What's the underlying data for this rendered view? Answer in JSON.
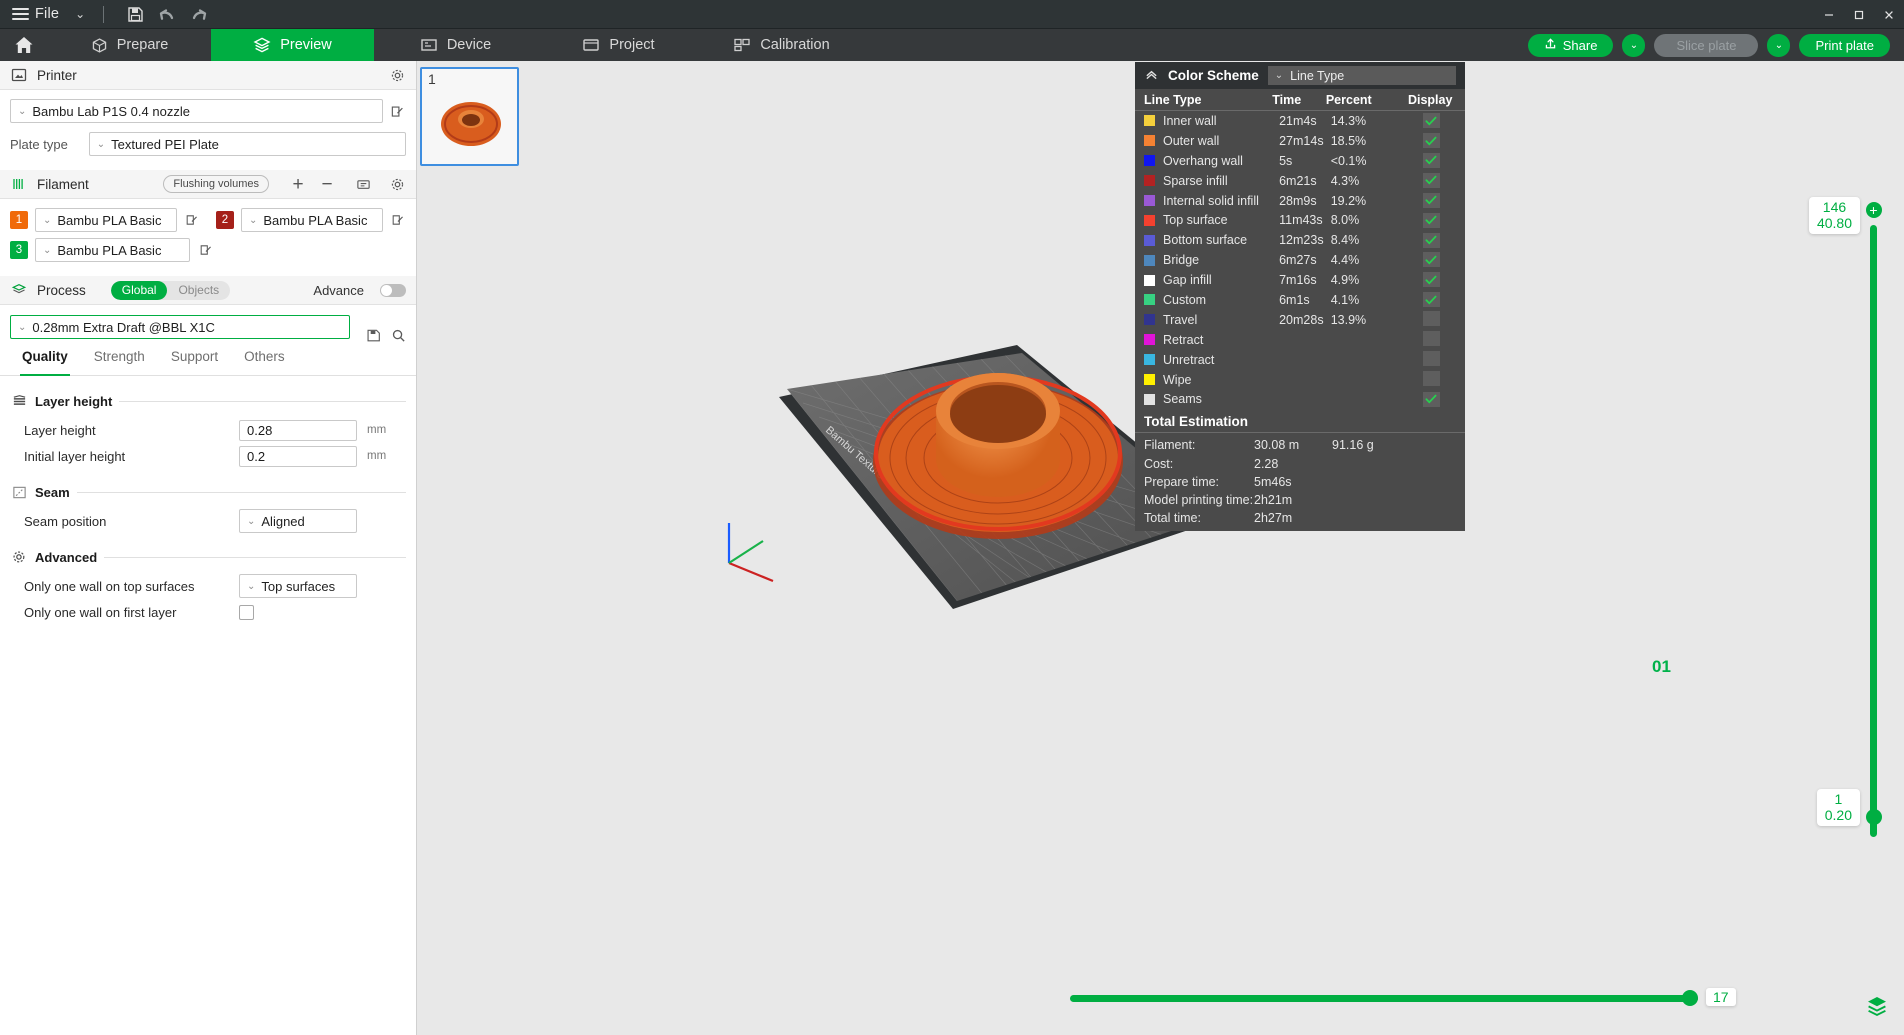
{
  "titlebar": {
    "menu_label": "File",
    "caret": "⌄",
    "icons": [
      "save-icon",
      "undo-icon",
      "redo-icon"
    ],
    "window_controls": [
      "minimize",
      "maximize",
      "close"
    ]
  },
  "tabs": [
    {
      "label": "Prepare",
      "icon": "cube-icon",
      "active": false
    },
    {
      "label": "Preview",
      "icon": "layers-icon",
      "active": true
    },
    {
      "label": "Device",
      "icon": "device-icon",
      "active": false
    },
    {
      "label": "Project",
      "icon": "folder-icon",
      "active": false
    },
    {
      "label": "Calibration",
      "icon": "calibration-icon",
      "active": false
    }
  ],
  "toolbar_right": {
    "share_label": "Share",
    "slice_label": "Slice plate",
    "print_label": "Print plate",
    "caret": "⌄"
  },
  "printer": {
    "section_title": "Printer",
    "preset": "Bambu Lab P1S 0.4 nozzle",
    "plate_type_label": "Plate type",
    "plate_type": "Textured PEI Plate"
  },
  "filament": {
    "section_title": "Filament",
    "flushing_label": "Flushing volumes",
    "add": "+",
    "remove": "−",
    "items": [
      {
        "index": "1",
        "name": "Bambu PLA Basic",
        "color": "#f06a0a"
      },
      {
        "index": "2",
        "name": "Bambu PLA Basic",
        "color": "#a52019"
      },
      {
        "index": "3",
        "name": "Bambu PLA Basic",
        "color": "#00ae42"
      }
    ]
  },
  "process": {
    "section_title": "Process",
    "scope_global": "Global",
    "scope_objects": "Objects",
    "advance_label": "Advance",
    "preset": "0.28mm Extra Draft @BBL X1C",
    "tabs": [
      {
        "label": "Quality",
        "active": true
      },
      {
        "label": "Strength",
        "active": false
      },
      {
        "label": "Support",
        "active": false
      },
      {
        "label": "Others",
        "active": false
      }
    ],
    "groups": [
      {
        "title": "Layer height",
        "icon": "layer-height-icon",
        "rows": [
          {
            "label": "Layer height",
            "type": "input",
            "value": "0.28",
            "unit": "mm"
          },
          {
            "label": "Initial layer height",
            "type": "input",
            "value": "0.2",
            "unit": "mm"
          }
        ]
      },
      {
        "title": "Seam",
        "icon": "seam-icon",
        "rows": [
          {
            "label": "Seam position",
            "type": "combo",
            "value": "Aligned",
            "unit": ""
          }
        ]
      },
      {
        "title": "Advanced",
        "icon": "gear-icon",
        "rows": [
          {
            "label": "Only one wall on top surfaces",
            "type": "combo",
            "value": "Top surfaces",
            "unit": ""
          },
          {
            "label": "Only one wall on first layer",
            "type": "checkbox",
            "value": "",
            "unit": ""
          }
        ]
      }
    ]
  },
  "plate_strip": {
    "thumbnail_number": "1"
  },
  "viewport": {
    "plate_label": "01",
    "bed_text": "Bambu Textured PEI Plate"
  },
  "color_scheme": {
    "title": "Color Scheme",
    "selected_view": "Line Type",
    "collapse_icon": "chevron-up-icon",
    "columns": [
      "Line Type",
      "Time",
      "Percent",
      "Display"
    ],
    "rows": [
      {
        "name": "Inner wall",
        "time": "21m4s",
        "percent": "14.3%",
        "color": "#f5d03c",
        "display": true
      },
      {
        "name": "Outer wall",
        "time": "27m14s",
        "percent": "18.5%",
        "color": "#f58233",
        "display": true
      },
      {
        "name": "Overhang wall",
        "time": "5s",
        "percent": "<0.1%",
        "color": "#1016f0",
        "display": true
      },
      {
        "name": "Sparse infill",
        "time": "6m21s",
        "percent": "4.3%",
        "color": "#b32222",
        "display": true
      },
      {
        "name": "Internal solid infill",
        "time": "28m9s",
        "percent": "19.2%",
        "color": "#9a59d6",
        "display": true
      },
      {
        "name": "Top surface",
        "time": "11m43s",
        "percent": "8.0%",
        "color": "#f4412f",
        "display": true
      },
      {
        "name": "Bottom surface",
        "time": "12m23s",
        "percent": "8.4%",
        "color": "#5a5bd6",
        "display": true
      },
      {
        "name": "Bridge",
        "time": "6m27s",
        "percent": "4.4%",
        "color": "#4e87bd",
        "display": true
      },
      {
        "name": "Gap infill",
        "time": "7m16s",
        "percent": "4.9%",
        "color": "#ffffff",
        "display": true
      },
      {
        "name": "Custom",
        "time": "6m1s",
        "percent": "4.1%",
        "color": "#37d182",
        "display": true
      },
      {
        "name": "Travel",
        "time": "20m28s",
        "percent": "13.9%",
        "color": "#31348f",
        "display": false
      },
      {
        "name": "Retract",
        "time": "",
        "percent": "",
        "color": "#e014d8",
        "display": false
      },
      {
        "name": "Unretract",
        "time": "",
        "percent": "",
        "color": "#39b6e0",
        "display": false
      },
      {
        "name": "Wipe",
        "time": "",
        "percent": "",
        "color": "#fff000",
        "display": false
      },
      {
        "name": "Seams",
        "time": "",
        "percent": "",
        "color": "#e2e2e2",
        "display": true
      }
    ],
    "total_title": "Total Estimation",
    "estimation": [
      {
        "label": "Filament:",
        "value": "30.08 m",
        "value2": "91.16 g"
      },
      {
        "label": "Cost:",
        "value": "2.28",
        "value2": ""
      },
      {
        "label": "Prepare time:",
        "value": "5m46s",
        "value2": ""
      },
      {
        "label": "Model printing time:",
        "value": "2h21m",
        "value2": ""
      },
      {
        "label": "Total time:",
        "value": "2h27m",
        "value2": ""
      }
    ]
  },
  "layer_slider": {
    "top_layer": "146",
    "top_height": "40.80",
    "bottom_layer": "1",
    "bottom_height": "0.20",
    "plus_label": "+"
  },
  "move_slider": {
    "value": "17"
  }
}
